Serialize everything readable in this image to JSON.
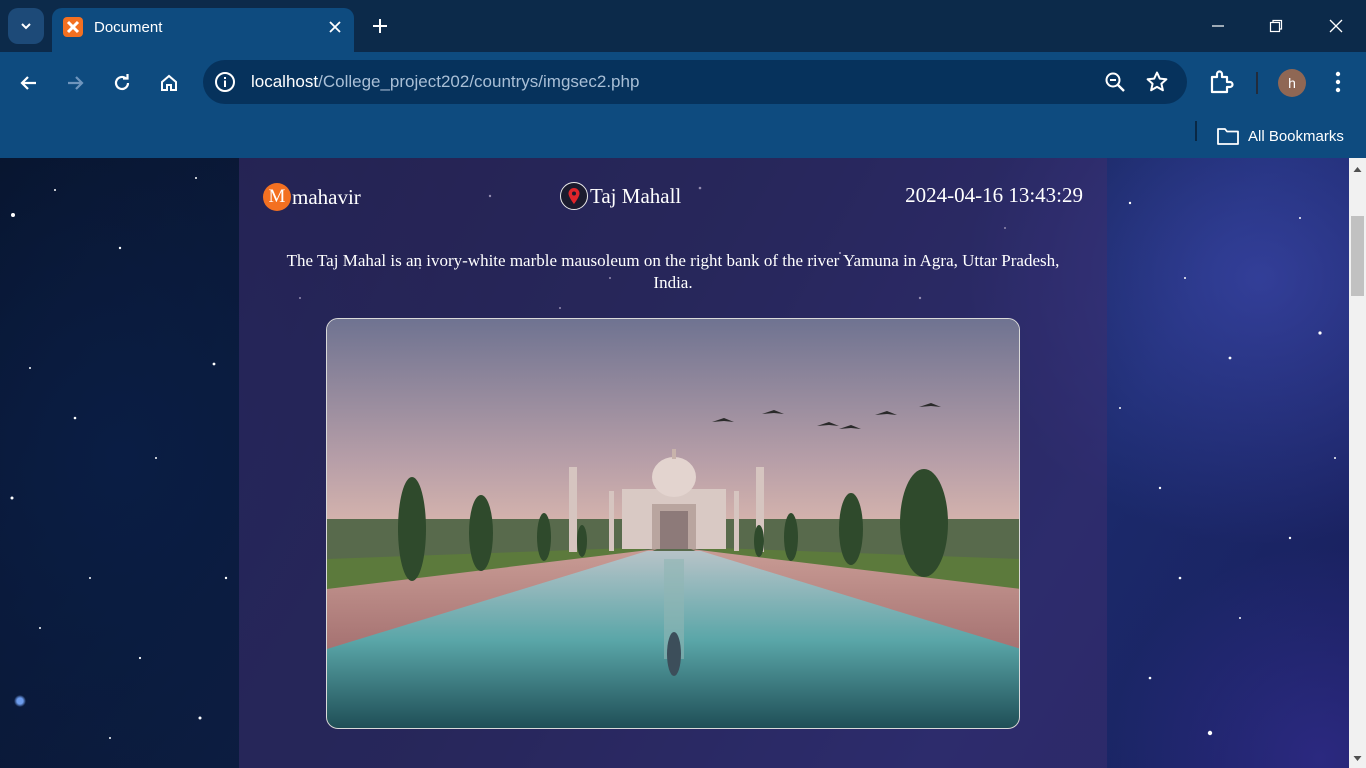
{
  "browser": {
    "tab_title": "Document",
    "url_host": "localhost",
    "url_path": "/College_project202/countrys/imgsec2.php",
    "profile_initial": "h",
    "bookmarks_label": "All Bookmarks"
  },
  "post": {
    "user_initial": "M",
    "username": "mahavir",
    "location": "Taj Mahall",
    "datetime": "2024-04-16 13:43:29",
    "description": "The Taj Mahal is an ivory-white marble mausoleum on the right bank of the river Yamuna in Agra, Uttar Pradesh, India."
  },
  "colors": {
    "chrome_dark": "#0c2a4a",
    "chrome": "#0e4b7f",
    "accent_orange": "#f37021"
  },
  "icons": [
    "dropdown-icon",
    "xampp-favicon",
    "close-icon",
    "plus-icon",
    "minimize-icon",
    "restore-icon",
    "back-icon",
    "forward-icon",
    "reload-icon",
    "home-icon",
    "info-icon",
    "zoom-icon",
    "star-icon",
    "extensions-icon",
    "kebab-menu-icon",
    "folder-icon",
    "location-pin-icon"
  ]
}
